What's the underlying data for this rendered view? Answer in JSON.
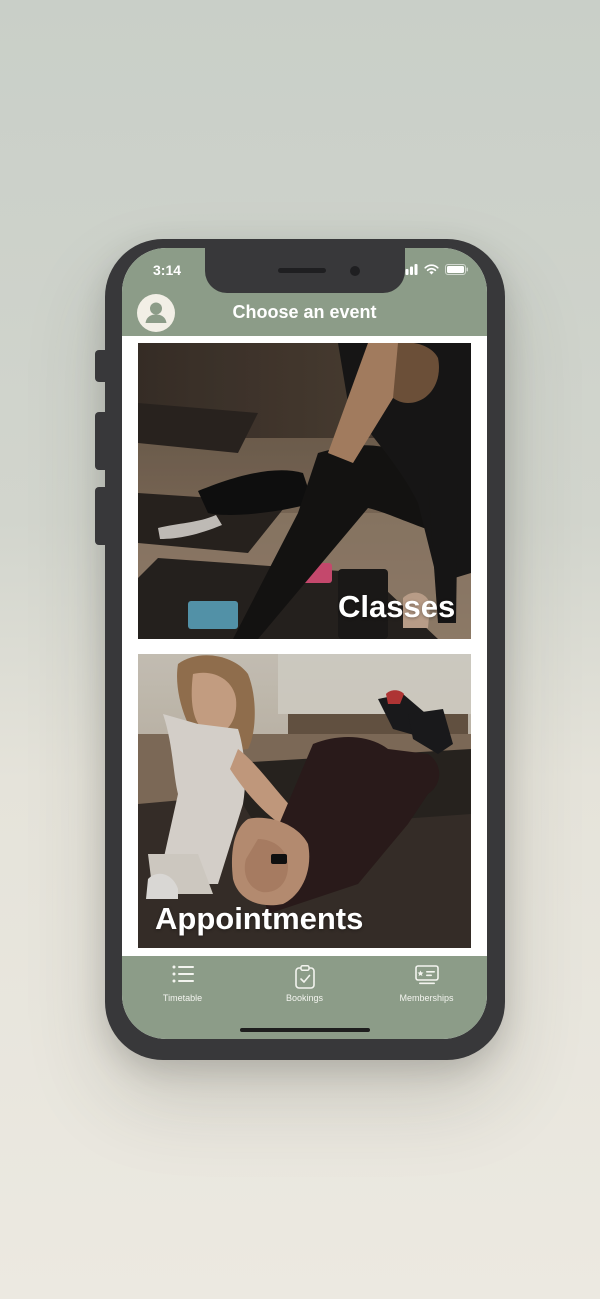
{
  "status_bar": {
    "time": "3:14"
  },
  "header": {
    "title": "Choose an event",
    "avatar_icon": "user-profile-icon"
  },
  "cards": [
    {
      "label": "Classes"
    },
    {
      "label": "Appointments"
    }
  ],
  "tabbar": {
    "items": [
      {
        "label": "Timetable",
        "icon": "list-icon"
      },
      {
        "label": "Bookings",
        "icon": "clipboard-check-icon"
      },
      {
        "label": "Memberships",
        "icon": "membership-card-icon"
      }
    ]
  },
  "colors": {
    "header_bg": "#8c9c88",
    "phone_frame": "#38383a",
    "avatar_bg": "#f2efe6"
  }
}
